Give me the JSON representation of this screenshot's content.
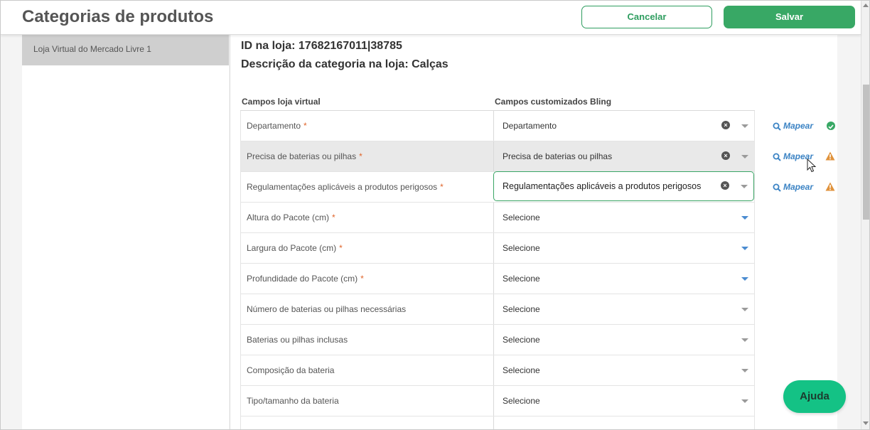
{
  "header": {
    "title": "Categorias de produtos",
    "cancel_label": "Cancelar",
    "save_label": "Salvar"
  },
  "sidebar": {
    "items": [
      {
        "label": "Loja Virtual do Mercado Livre 1"
      }
    ]
  },
  "panel": {
    "id_line": "ID na loja: 17682167011|38785",
    "desc_line": "Descrição da categoria na loja: Calças",
    "col_left": "Campos loja virtual",
    "col_right": "Campos customizados Bling"
  },
  "rows": [
    {
      "label": "Departamento",
      "required": "*",
      "value": "Departamento",
      "mapear": "Mapear",
      "status": "ok"
    },
    {
      "label": "Precisa de baterias ou pilhas",
      "required": "*",
      "value": "Precisa de baterias ou pilhas",
      "mapear": "Mapear",
      "status": "warning"
    },
    {
      "label": "Regulamentações aplicáveis a produtos perigosos",
      "required": "*",
      "value": "Regulamentações aplicáveis a produtos perigosos",
      "mapear": "Mapear",
      "status": "warning"
    },
    {
      "label": "Altura do Pacote (cm)",
      "required": "*",
      "value": "Selecione"
    },
    {
      "label": "Largura do Pacote (cm)",
      "required": "*",
      "value": "Selecione"
    },
    {
      "label": "Profundidade do Pacote (cm)",
      "required": "*",
      "value": "Selecione"
    },
    {
      "label": "Número de baterias ou pilhas necessárias",
      "value": "Selecione"
    },
    {
      "label": "Baterias ou pilhas inclusas",
      "value": "Selecione"
    },
    {
      "label": "Composição da bateria",
      "value": "Selecione"
    },
    {
      "label": "Tipo/tamanho da bateria",
      "value": "Selecione"
    }
  ],
  "help_label": "Ajuda",
  "icons": {
    "search": "magnifier-icon",
    "ok": "check-circle-icon",
    "warning": "warning-triangle-icon",
    "clear": "clear-x-icon",
    "dropdown": "chevron-down-icon"
  },
  "colors": {
    "brand_green": "#38a865",
    "link_blue": "#3b83c4",
    "warning_orange": "#e0923b",
    "required_orange": "#e0652b"
  }
}
